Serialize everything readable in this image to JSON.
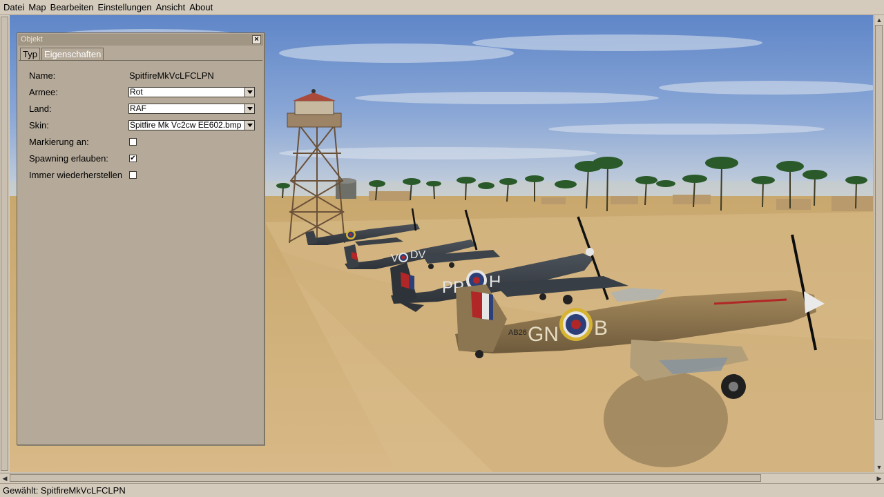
{
  "menu": [
    "Datei",
    "Map",
    "Bearbeiten",
    "Einstellungen",
    "Ansicht",
    "About"
  ],
  "panel": {
    "title": "Objekt",
    "close_glyph": "×",
    "tabs": [
      "Typ",
      "Eigenschaften"
    ],
    "active_tab": "Eigenschaften",
    "name_label": "Name:",
    "name_value": "SpitfireMkVcLFCLPN",
    "armee_label": "Armee:",
    "armee_value": "Rot",
    "land_label": "Land:",
    "land_value": "RAF",
    "skin_label": "Skin:",
    "skin_value": "Spitfire Mk Vc2cw EE602.bmp",
    "marker_label": "Markierung an:",
    "marker_checked": false,
    "spawn_label": "Spawning erlauben:",
    "spawn_checked": true,
    "restore_label": "Immer wiederherstellen",
    "restore_checked": false,
    "check_glyph": "✔"
  },
  "status": {
    "text": "Gewählt: SpitfireMkVcLFCLPN"
  },
  "aircraft_markings": [
    {
      "code_left": "GN",
      "code_right": "B",
      "serial": "AB26"
    },
    {
      "code_left": "PP",
      "code_right": "H"
    },
    {
      "code_left": "V",
      "code_right": "DV"
    }
  ],
  "colors": {
    "ui_background": "#d4cbbd",
    "panel_background": "#b5aa9a",
    "sky": "#7a9ad0",
    "sand": "#cfae78",
    "roundel_red": "#b12626",
    "roundel_blue": "#2c3f78",
    "roundel_yellow": "#d6b431"
  },
  "icons": {
    "close": "close-icon",
    "dropdown": "chevron-down-icon",
    "scroll_up": "arrow-up-icon",
    "scroll_down": "arrow-down-icon",
    "scroll_left": "arrow-left-icon",
    "scroll_right": "arrow-right-icon"
  }
}
